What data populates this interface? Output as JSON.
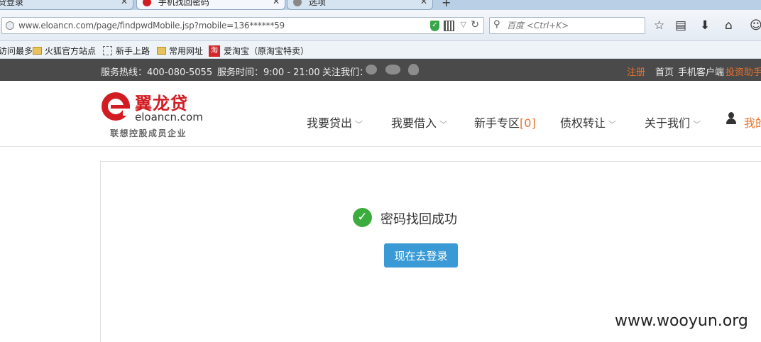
{
  "browser": {
    "tabs": [
      {
        "title": "贷登录"
      },
      {
        "title": "手机找回密码"
      },
      {
        "title": "选项"
      }
    ],
    "url": "www.eloancn.com/page/findpwdMobile.jsp?mobile=136******59",
    "search_placeholder": "百度 <Ctrl+K>",
    "bookmarks": [
      {
        "label": "访问最多"
      },
      {
        "label": "火狐官方站点"
      },
      {
        "label": "新手上路"
      },
      {
        "label": "常用网址"
      },
      {
        "label": "爱淘宝（原淘宝特卖）"
      }
    ]
  },
  "topbar": {
    "hotline": "服务热线：400-080-5055",
    "service_time": "服务时间：9:00 - 21:00",
    "follow": "关注我们：",
    "register": "注册",
    "home": "首页",
    "mobile_client": "手机客户端",
    "invest_helper": "投资助手"
  },
  "header": {
    "logo_cn": "翼龙贷",
    "logo_en": "eloancn.com",
    "logo_sub": "联想控股成员企业",
    "nav": {
      "lend": "我要贷出",
      "borrow": "我要借入",
      "newbie": "新手专区",
      "newbie_badge": "[0]",
      "transfer": "债权转让",
      "about": "关于我们",
      "my": "我的"
    }
  },
  "main": {
    "success_message": "密码找回成功",
    "login_button": "现在去登录"
  },
  "watermark": "www.wooyun.org",
  "colors": {
    "brand_red": "#d11c22",
    "accent_orange": "#e9722d",
    "button_blue": "#3a9ad6",
    "success_green": "#3cac3e",
    "topbar_bg": "#4a4a4a"
  }
}
